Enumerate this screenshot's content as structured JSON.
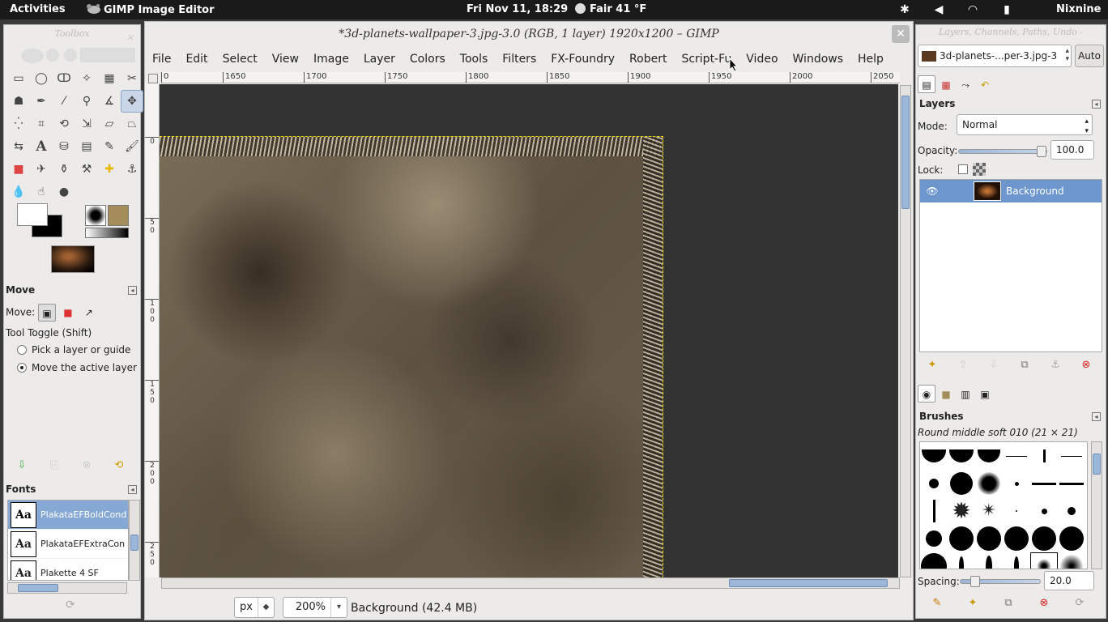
{
  "topbar": {
    "activities": "Activities",
    "app_name": "GIMP Image Editor",
    "clock": "Fri Nov 11, 18:29",
    "weather": "Fair 41 °F",
    "user": "Nixnine"
  },
  "toolbox": {
    "title": "Toolbox",
    "tool_options": {
      "title": "Move",
      "move_label": "Move:",
      "tool_toggle": "Tool Toggle  (Shift)",
      "options": [
        "Pick a layer or guide",
        "Move the active layer"
      ],
      "selected_option": 1
    },
    "fonts": {
      "title": "Fonts",
      "items": [
        "PlakataEFBoldCond",
        "PlakataEFExtraCon",
        "Plakette 4 SF"
      ],
      "glyph": "Aa"
    }
  },
  "image_window": {
    "title": "*3d-planets-wallpaper-3.jpg-3.0 (RGB, 1 layer) 1920x1200 – GIMP",
    "menu": [
      "File",
      "Edit",
      "Select",
      "View",
      "Image",
      "Layer",
      "Colors",
      "Tools",
      "Filters",
      "FX-Foundry",
      "Robert",
      "Script-Fu",
      "Video",
      "Windows",
      "Help"
    ],
    "ruler_h": [
      "0",
      "1650",
      "1700",
      "1750",
      "1800",
      "1850",
      "1900",
      "1950",
      "2000",
      "2050"
    ],
    "ruler_v": [
      "0",
      "50",
      "100",
      "150",
      "200",
      "250"
    ],
    "unit": "px",
    "zoom": "200%",
    "status": "Background (42.4 MB)"
  },
  "dock": {
    "title": "Layers, Channels, Paths, Undo -",
    "image_selector": "3d-planets-...per-3.jpg-3",
    "auto_label": "Auto",
    "layers": {
      "title": "Layers",
      "mode_label": "Mode:",
      "mode_value": "Normal",
      "opacity_label": "Opacity:",
      "opacity_value": "100.0",
      "lock_label": "Lock:",
      "layer_name": "Background"
    },
    "brushes": {
      "title": "Brushes",
      "brush_name": "Round  middle soft 010 (21 × 21)",
      "spacing_label": "Spacing:",
      "spacing_value": "20.0"
    }
  }
}
